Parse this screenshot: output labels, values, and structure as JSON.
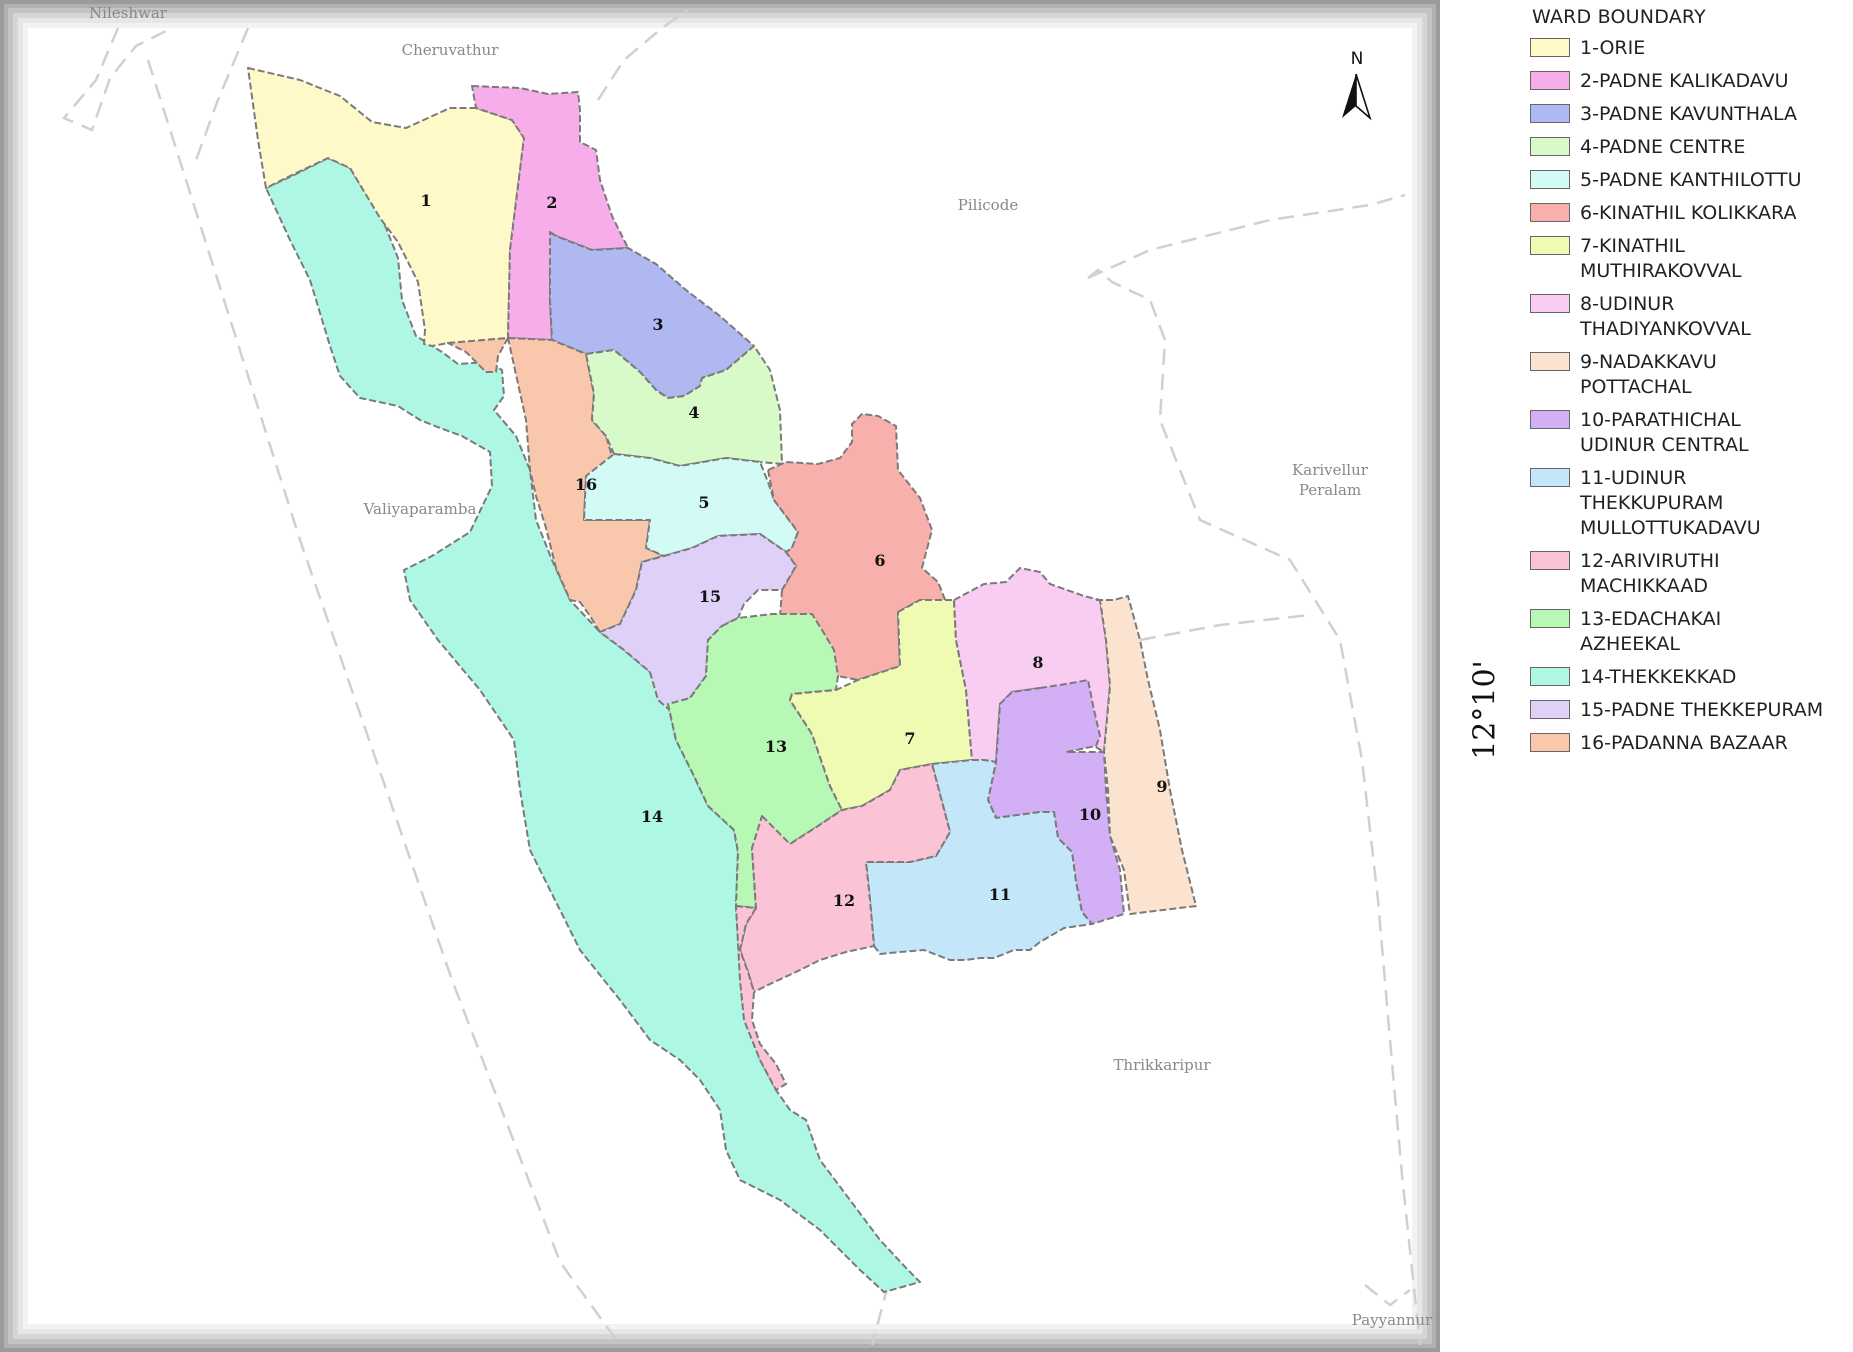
{
  "map": {
    "places": {
      "nileshwar": "Nileshwar",
      "cheruvathur": "Cheruvathur",
      "pilicode": "Pilicode",
      "karivellur_line1": "Karivellur",
      "karivellur_line2": "Peralam",
      "valiyaparamba": "Valiyaparamba",
      "thrikkaripur": "Thrikkaripur",
      "payyannur": "Payyannur"
    },
    "north_arrow_label": "N",
    "latitude_label": "12°10'",
    "wards": [
      {
        "number": "1",
        "color": "#FFF9C9"
      },
      {
        "number": "2",
        "color": "#F8ADEB"
      },
      {
        "number": "3",
        "color": "#AFB8F1"
      },
      {
        "number": "4",
        "color": "#D8F9C8"
      },
      {
        "number": "5",
        "color": "#D2FBF6"
      },
      {
        "number": "6",
        "color": "#F8B0AC"
      },
      {
        "number": "7",
        "color": "#EFFBB2"
      },
      {
        "number": "8",
        "color": "#F9CCF1"
      },
      {
        "number": "9",
        "color": "#FCE3CF"
      },
      {
        "number": "10",
        "color": "#D3AFF6"
      },
      {
        "number": "11",
        "color": "#C3E7F9"
      },
      {
        "number": "12",
        "color": "#FAC3D6"
      },
      {
        "number": "13",
        "color": "#B7F8B5"
      },
      {
        "number": "14",
        "color": "#AEF7E4"
      },
      {
        "number": "15",
        "color": "#DFD0F8"
      },
      {
        "number": "16",
        "color": "#F8C7AC"
      }
    ]
  },
  "legend": {
    "title": "WARD BOUNDARY",
    "items": [
      {
        "label": "1-ORIE",
        "color": "#FFF9C9"
      },
      {
        "label": "2-PADNE KALIKADAVU",
        "color": "#F8ADEB"
      },
      {
        "label": "3-PADNE KAVUNTHALA",
        "color": "#AFB8F1"
      },
      {
        "label": "4-PADNE CENTRE",
        "color": "#D8F9C8"
      },
      {
        "label": "5-PADNE KANTHILOTTU",
        "color": "#D2FBF6"
      },
      {
        "label": "6-KINATHIL KOLIKKARA",
        "color": "#F8B0AC"
      },
      {
        "label": "7-KINATHIL\nMUTHIRAKOVVAL",
        "color": "#EFFBB2"
      },
      {
        "label": "8-UDINUR\nTHADIYANKOVVAL",
        "color": "#F9CCF1"
      },
      {
        "label": "9-NADAKKAVU\nPOTTACHAL",
        "color": "#FCE3CF"
      },
      {
        "label": "10-PARATHICHAL\nUDINUR CENTRAL",
        "color": "#D3AFF6"
      },
      {
        "label": "11-UDINUR\nTHEKKUPURAM\nMULLOTTUKADAVU",
        "color": "#C3E7F9"
      },
      {
        "label": "12-ARIVIRUTHI\nMACHIKKAAD",
        "color": "#FAC3D6"
      },
      {
        "label": "13-EDACHAKAI\nAZHEEKAL",
        "color": "#B7F8B5"
      },
      {
        "label": "14-THEKKEKKAD",
        "color": "#AEF7E4"
      },
      {
        "label": "15-PADNE THEKKEPURAM",
        "color": "#DFD0F8"
      },
      {
        "label": "16-PADANNA BAZAAR",
        "color": "#F8C7AC"
      }
    ]
  }
}
